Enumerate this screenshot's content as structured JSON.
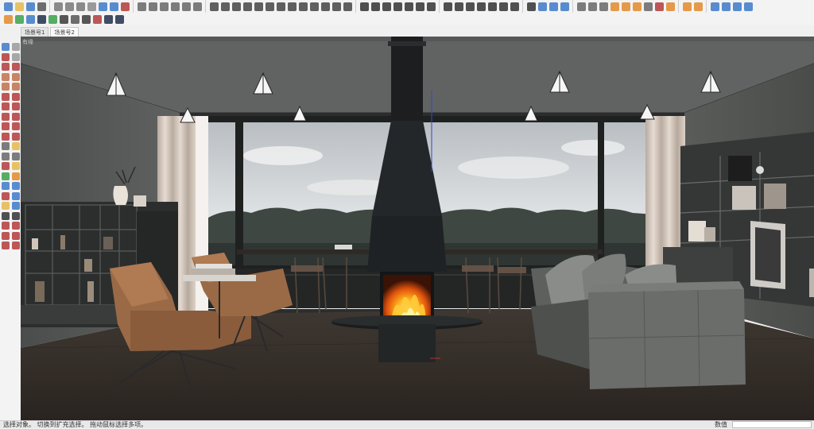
{
  "toolbar_row1": {
    "groups": [
      {
        "name": "file",
        "icons": [
          {
            "id": "new-file-icon",
            "color": "#3c79c8"
          },
          {
            "id": "open-folder-icon",
            "color": "#e4b84a"
          },
          {
            "id": "save-icon",
            "color": "#3c79c8"
          },
          {
            "id": "print-icon",
            "color": "#555555"
          }
        ]
      },
      {
        "name": "edit",
        "icons": [
          {
            "id": "cut-icon",
            "color": "#777777"
          },
          {
            "id": "copy-icon",
            "color": "#777777"
          },
          {
            "id": "paste-icon",
            "color": "#777777"
          },
          {
            "id": "erase-icon",
            "color": "#888888"
          },
          {
            "id": "undo-icon",
            "color": "#3c79c8"
          },
          {
            "id": "redo-icon",
            "color": "#3c79c8"
          },
          {
            "id": "model-info-icon",
            "color": "#b33b3b"
          }
        ]
      },
      {
        "name": "views",
        "icons": [
          {
            "id": "iso-view-icon",
            "color": "#666666"
          },
          {
            "id": "top-view-icon",
            "color": "#666666"
          },
          {
            "id": "front-view-icon",
            "color": "#666666"
          },
          {
            "id": "right-view-icon",
            "color": "#666666"
          },
          {
            "id": "back-view-icon",
            "color": "#666666"
          },
          {
            "id": "left-view-icon",
            "color": "#666666"
          }
        ]
      },
      {
        "name": "plugins",
        "icons": [
          {
            "id": "profile-builder-icon",
            "color": "#444444"
          },
          {
            "id": "stairs-icon",
            "color": "#444444"
          },
          {
            "id": "wave-icon",
            "color": "#444444"
          },
          {
            "id": "curve-icon",
            "color": "#444444"
          },
          {
            "id": "spiral-icon",
            "color": "#444444"
          },
          {
            "id": "loop-icon",
            "color": "#444444"
          },
          {
            "id": "pen-icon",
            "color": "#444444"
          },
          {
            "id": "extrude-icon",
            "color": "#444444"
          },
          {
            "id": "bend-icon",
            "color": "#444444"
          },
          {
            "id": "twist-icon",
            "color": "#444444"
          },
          {
            "id": "drape-icon",
            "color": "#444444"
          },
          {
            "id": "stack-icon",
            "color": "#444444"
          },
          {
            "id": "mirror-icon",
            "color": "#444444"
          }
        ]
      },
      {
        "name": "modify",
        "icons": [
          {
            "id": "dome-icon",
            "color": "#333333"
          },
          {
            "id": "dash-line-icon",
            "color": "#333333"
          },
          {
            "id": "dot-line-icon",
            "color": "#333333"
          },
          {
            "id": "target-icon",
            "color": "#333333"
          },
          {
            "id": "shear-icon",
            "color": "#333333"
          },
          {
            "id": "grid-icon",
            "color": "#333333"
          },
          {
            "id": "sun-icon",
            "color": "#333333"
          }
        ]
      },
      {
        "name": "shapes",
        "icons": [
          {
            "id": "pyramid-icon",
            "color": "#333333"
          },
          {
            "id": "bars-icon",
            "color": "#333333"
          },
          {
            "id": "shade-icon",
            "color": "#333333"
          },
          {
            "id": "align-icon",
            "color": "#333333"
          },
          {
            "id": "up-arrow-icon",
            "color": "#333333"
          },
          {
            "id": "circle-icon",
            "color": "#333333"
          },
          {
            "id": "ring-icon",
            "color": "#333333"
          }
        ]
      },
      {
        "name": "camera",
        "icons": [
          {
            "id": "move-cursor-icon",
            "color": "#333333"
          },
          {
            "id": "orbit-icon",
            "color": "#3c79c8"
          },
          {
            "id": "pan-icon",
            "color": "#3c79c8"
          },
          {
            "id": "zoom-icon",
            "color": "#3c79c8"
          }
        ]
      },
      {
        "name": "draw",
        "icons": [
          {
            "id": "pencil-icon",
            "color": "#666666"
          },
          {
            "id": "brush-icon",
            "color": "#666666"
          },
          {
            "id": "tape-icon",
            "color": "#666666"
          },
          {
            "id": "paint-bucket-icon",
            "color": "#e08a2c"
          },
          {
            "id": "box-icon",
            "color": "#e08a2c"
          },
          {
            "id": "component-icon",
            "color": "#e08a2c"
          },
          {
            "id": "select-icon",
            "color": "#666666"
          },
          {
            "id": "scissors-icon",
            "color": "#b33b3b"
          },
          {
            "id": "pipe-icon",
            "color": "#e08a2c"
          }
        ]
      },
      {
        "name": "render",
        "icons": [
          {
            "id": "render-icon",
            "color": "#e08a2c"
          },
          {
            "id": "frame-icon",
            "color": "#e08a2c"
          }
        ]
      },
      {
        "name": "cloud",
        "icons": [
          {
            "id": "sync-icon",
            "color": "#3c79c8"
          },
          {
            "id": "cloud-icon",
            "color": "#3c79c8"
          },
          {
            "id": "cloud-upload-icon",
            "color": "#3c79c8"
          },
          {
            "id": "settings-icon",
            "color": "#3c79c8"
          }
        ]
      }
    ]
  },
  "toolbar_row2": {
    "icons": [
      {
        "id": "shapes-icon",
        "color": "#e08a2c"
      },
      {
        "id": "swap-icon",
        "color": "#3aa04a"
      },
      {
        "id": "layers-icon",
        "color": "#3c79c8"
      },
      {
        "id": "add-circle-icon",
        "color": "#1f2f4a"
      },
      {
        "id": "gem-icon",
        "color": "#3aa04a"
      },
      {
        "id": "cube-icon",
        "color": "#3a3a3a"
      },
      {
        "id": "checker-icon",
        "color": "#555555"
      },
      {
        "id": "cloud-download-icon",
        "color": "#3a3a3a"
      },
      {
        "id": "warehouse-icon",
        "color": "#b33b3b"
      },
      {
        "id": "mail-icon",
        "color": "#1f2f4a"
      },
      {
        "id": "info-icon",
        "color": "#1f2f4a"
      }
    ]
  },
  "scene_tabs": [
    "场景号1",
    "场景号2"
  ],
  "active_scene": 1,
  "left_tools": [
    {
      "id": "select-arrow-icon",
      "color": "#3c79c8"
    },
    {
      "id": "eraser-icon",
      "color": "#999999"
    },
    {
      "id": "paint-icon",
      "color": "#b33b3b"
    },
    {
      "id": "component-make-icon",
      "color": "#999999"
    },
    {
      "id": "line-icon",
      "color": "#b33b3b"
    },
    {
      "id": "freehand-icon",
      "color": "#b33b3b"
    },
    {
      "id": "rectangle-icon",
      "color": "#c0704a"
    },
    {
      "id": "rotated-rect-icon",
      "color": "#c0704a"
    },
    {
      "id": "circle-tool-icon",
      "color": "#c0704a"
    },
    {
      "id": "polygon-icon",
      "color": "#c0704a"
    },
    {
      "id": "arc-icon",
      "color": "#b33b3b"
    },
    {
      "id": "pie-icon",
      "color": "#b33b3b"
    },
    {
      "id": "arc2-icon",
      "color": "#b33b3b"
    },
    {
      "id": "arc3-icon",
      "color": "#b33b3b"
    },
    {
      "id": "move-icon",
      "color": "#b33b3b"
    },
    {
      "id": "push-pull-icon",
      "color": "#b33b3b"
    },
    {
      "id": "rotate-icon",
      "color": "#b33b3b"
    },
    {
      "id": "follow-me-icon",
      "color": "#b33b3b"
    },
    {
      "id": "scale-icon",
      "color": "#b33b3b"
    },
    {
      "id": "offset-icon",
      "color": "#b33b3b"
    },
    {
      "id": "tape-measure-icon",
      "color": "#666666"
    },
    {
      "id": "dimension-icon",
      "color": "#e4b84a"
    },
    {
      "id": "protractor-icon",
      "color": "#666666"
    },
    {
      "id": "text-icon",
      "color": "#666666"
    },
    {
      "id": "axes-icon",
      "color": "#b33b3b"
    },
    {
      "id": "3d-text-icon",
      "color": "#e4b84a"
    },
    {
      "id": "orbit-tool-icon",
      "color": "#3aa04a"
    },
    {
      "id": "pan-tool-icon",
      "color": "#e08a2c"
    },
    {
      "id": "zoom-tool-icon",
      "color": "#3c79c8"
    },
    {
      "id": "zoom-window-icon",
      "color": "#3c79c8"
    },
    {
      "id": "zoom-extents-icon",
      "color": "#b33b3b"
    },
    {
      "id": "previous-view-icon",
      "color": "#3c79c8"
    },
    {
      "id": "position-camera-icon",
      "color": "#e4b84a"
    },
    {
      "id": "look-around-icon",
      "color": "#3c79c8"
    },
    {
      "id": "walk-icon",
      "color": "#333333"
    },
    {
      "id": "section-icon",
      "color": "#333333"
    },
    {
      "id": "outliner-icon",
      "color": "#b33b3b"
    },
    {
      "id": "sandbox-icon",
      "color": "#b33b3b"
    },
    {
      "id": "terrain-icon",
      "color": "#b33b3b"
    },
    {
      "id": "stamp-icon",
      "color": "#b33b3b"
    },
    {
      "id": "drape-tool-icon",
      "color": "#b33b3b"
    },
    {
      "id": "flip-edge-icon",
      "color": "#b33b3b"
    }
  ],
  "viewport": {
    "overlay_label": "有缘"
  },
  "statusbar": {
    "hint": "选择对象。 切换到扩充选择。 拖动鼠标选择多项。",
    "value_label": "数值",
    "value": ""
  }
}
